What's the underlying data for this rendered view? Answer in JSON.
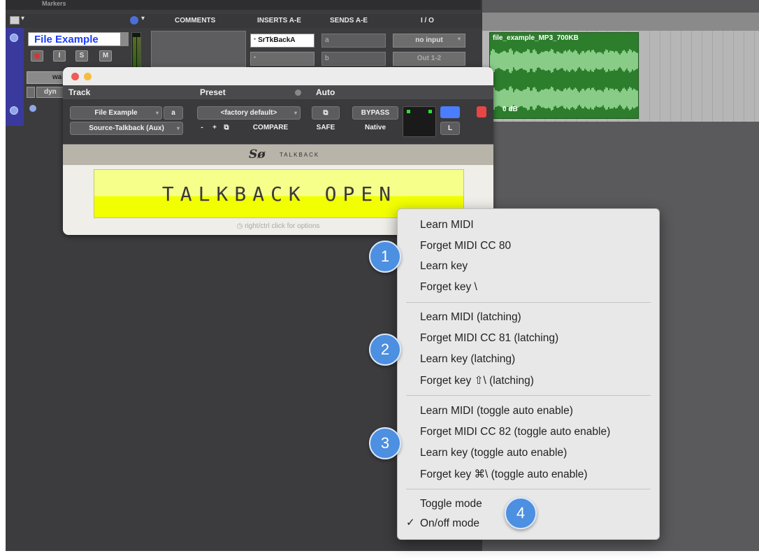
{
  "mix": {
    "markers_label": "Markers",
    "headers": {
      "comments": "COMMENTS",
      "inserts": "INSERTS A-E",
      "sends": "SENDS A-E",
      "io": "I / O"
    },
    "track_name": "File Example",
    "buttons": {
      "input": "I",
      "solo": "S",
      "mute": "M"
    },
    "insert_a": "SrTkBackA",
    "insert_b": "",
    "send_a": "a",
    "send_b": "b",
    "io_input": "no input",
    "io_output": "Out 1-2",
    "wave_label": "wa",
    "dyn_label": "dyn"
  },
  "arrange": {
    "clip_name": "file_example_MP3_700KB",
    "clip_gain": "0 dB"
  },
  "plugin": {
    "headers": {
      "track": "Track",
      "preset": "Preset",
      "auto": "Auto"
    },
    "track_select": "File Example",
    "track_channel": "a",
    "preset_select": "<factory default>",
    "bypass": "BYPASS",
    "source_select": "Source-Talkback (Aux)",
    "preset_minus": "-",
    "preset_plus": "+",
    "compare": "COMPARE",
    "safe": "SAFE",
    "native": "Native",
    "channel": "L",
    "brand_logo": "Sø",
    "brand_name": "TALKBACK",
    "display": "TALKBACK OPEN",
    "hint": "right/ctrl click for options"
  },
  "menu": {
    "groups": [
      [
        "Learn MIDI",
        "Forget MIDI CC 80",
        "Learn key",
        "Forget key \\"
      ],
      [
        "Learn MIDI (latching)",
        "Forget MIDI CC 81 (latching)",
        "Learn key (latching)",
        "Forget key ⇧\\ (latching)"
      ],
      [
        "Learn MIDI (toggle auto enable)",
        "Forget MIDI CC 82 (toggle auto enable)",
        "Learn key (toggle auto enable)",
        "Forget key ⌘\\ (toggle auto enable)"
      ],
      [
        "Toggle mode",
        "On/off mode"
      ]
    ],
    "checked": "On/off mode",
    "check_glyph": "✓"
  },
  "badges": [
    "1",
    "2",
    "3",
    "4"
  ]
}
